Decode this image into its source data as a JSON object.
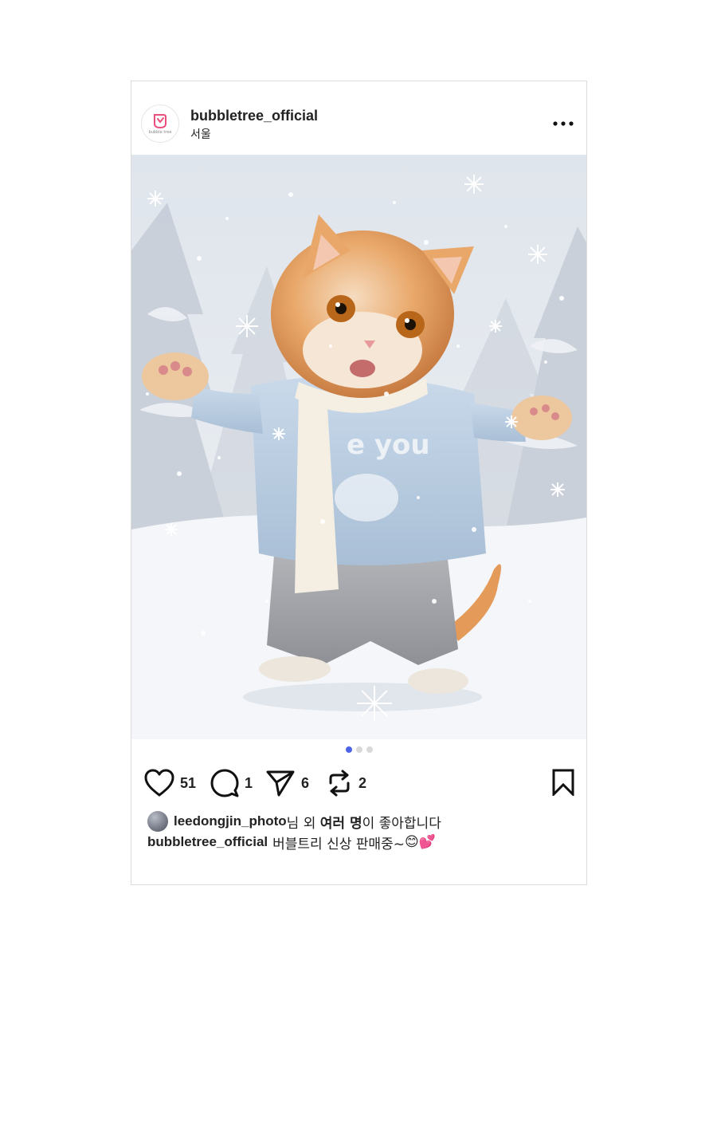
{
  "post": {
    "username": "bubbletree_official",
    "location": "서울",
    "avatar_text": "bubble tree",
    "more_icon": "more-horizontal-icon",
    "photo_description_icon": "cat-photo",
    "carousel": {
      "count": 3,
      "active": 1
    },
    "actions": {
      "likes": "51",
      "comments": "1",
      "shares": "6",
      "reposts": "2"
    },
    "liked_by": {
      "user": "leedongjin_photo",
      "suffix_1": "님 외 ",
      "others": "여러 명",
      "suffix_2": "이 좋아합니다"
    },
    "caption": {
      "user": "bubbletree_official",
      "text": "버블트리 신상 판매중~",
      "emojis": "😊💕"
    }
  },
  "colors": {
    "accent_dot": "#4a63e7",
    "inactive_dot": "#d9d9d9",
    "brand_pink": "#e94f7a"
  }
}
